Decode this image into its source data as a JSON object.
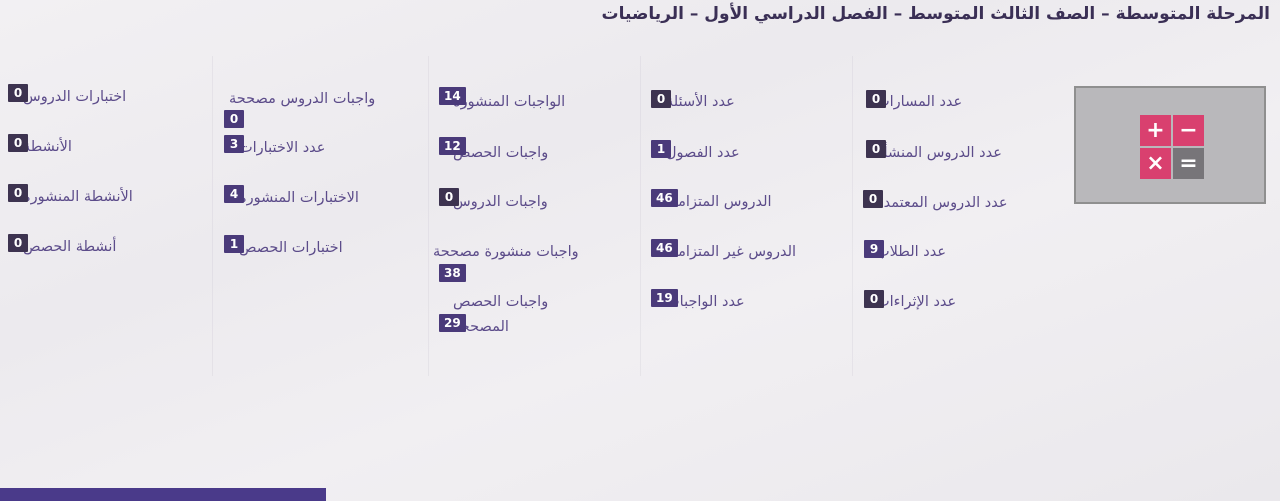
{
  "header": {
    "title": "المرحلة المتوسطة – الصف الثالث المتوسط – الفصل الدراسي الأول – الرياضيات"
  },
  "icon": {
    "name": "calculator-icon",
    "plus": "+",
    "minus": "−",
    "times": "×",
    "equals": "="
  },
  "stats": {
    "col1": [
      {
        "label": "عدد المسارات",
        "value": "0"
      },
      {
        "label": "عدد الدروس المنشأة",
        "value": "0"
      },
      {
        "label": "عدد الدروس المعتمدة",
        "value": "0"
      },
      {
        "label": "عدد الطلاب",
        "value": "9"
      },
      {
        "label": "عدد الإثراءات",
        "value": "0"
      }
    ],
    "col2": [
      {
        "label": "عدد الأسئلة",
        "value": "0"
      },
      {
        "label": "عدد الفصول",
        "value": "1"
      },
      {
        "label": "الدروس المتزامنة",
        "value": "46"
      },
      {
        "label": "الدروس غير المتزامنة",
        "value": "46"
      },
      {
        "label": "عدد الواجبات",
        "value": "19"
      }
    ],
    "col3": [
      {
        "label": "الواجبات المنشورة",
        "value": "14"
      },
      {
        "label": "واجبات الحصص",
        "value": "12"
      },
      {
        "label": "واجبات الدروس",
        "value": "0"
      },
      {
        "label": "واجبات منشورة مصححة",
        "value": "38"
      },
      {
        "label": "واجبات الحصص",
        "label2": "المصححة",
        "value": "29"
      }
    ],
    "col4": [
      {
        "label": "واجبات الدروس مصححة",
        "value": "0"
      },
      {
        "label": "عدد الاختبارات",
        "value": "3"
      },
      {
        "label": "الاختبارات المنشورة",
        "value": "4"
      },
      {
        "label": "اختبارات الحصص",
        "value": "1"
      }
    ],
    "col5": [
      {
        "label": "اختبارات الدروس",
        "value": "0"
      },
      {
        "label": "الأنشطة",
        "value": "0"
      },
      {
        "label": "الأنشطة المنشورة",
        "value": "0"
      },
      {
        "label": "أنشطة الحصص",
        "value": "0"
      }
    ]
  }
}
